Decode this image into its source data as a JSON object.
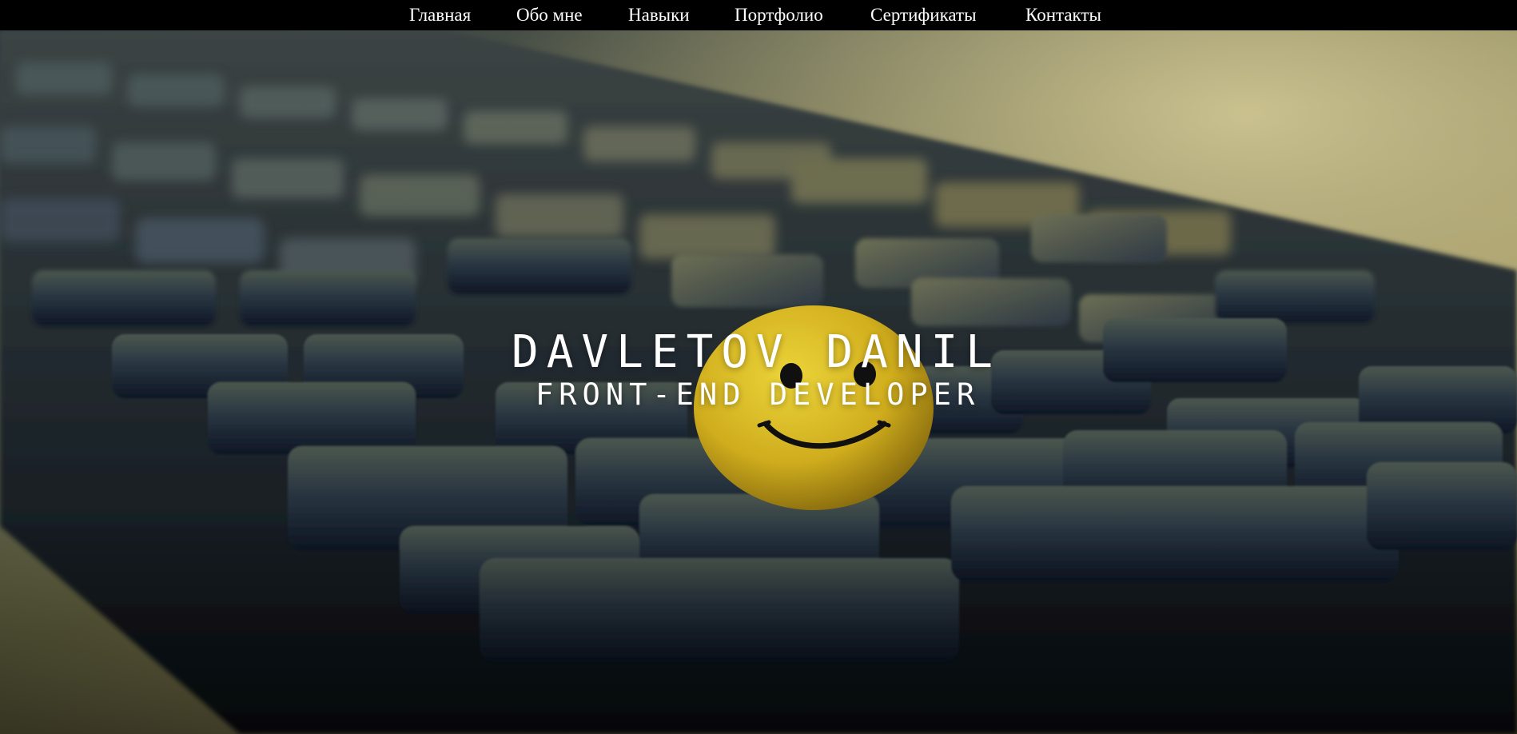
{
  "nav": {
    "items": [
      {
        "label": "Главная"
      },
      {
        "label": "Обо мне"
      },
      {
        "label": "Навыки"
      },
      {
        "label": "Портфолио"
      },
      {
        "label": "Сертификаты"
      },
      {
        "label": "Контакты"
      }
    ]
  },
  "hero": {
    "name": "DAVLETOV DANIL",
    "role": "FRONT-END DEVELOPER",
    "background": "keyboard-with-smiley-photo"
  },
  "colors": {
    "navbar_bg": "#000000",
    "text": "#ffffff",
    "smiley": "#e2c227"
  }
}
